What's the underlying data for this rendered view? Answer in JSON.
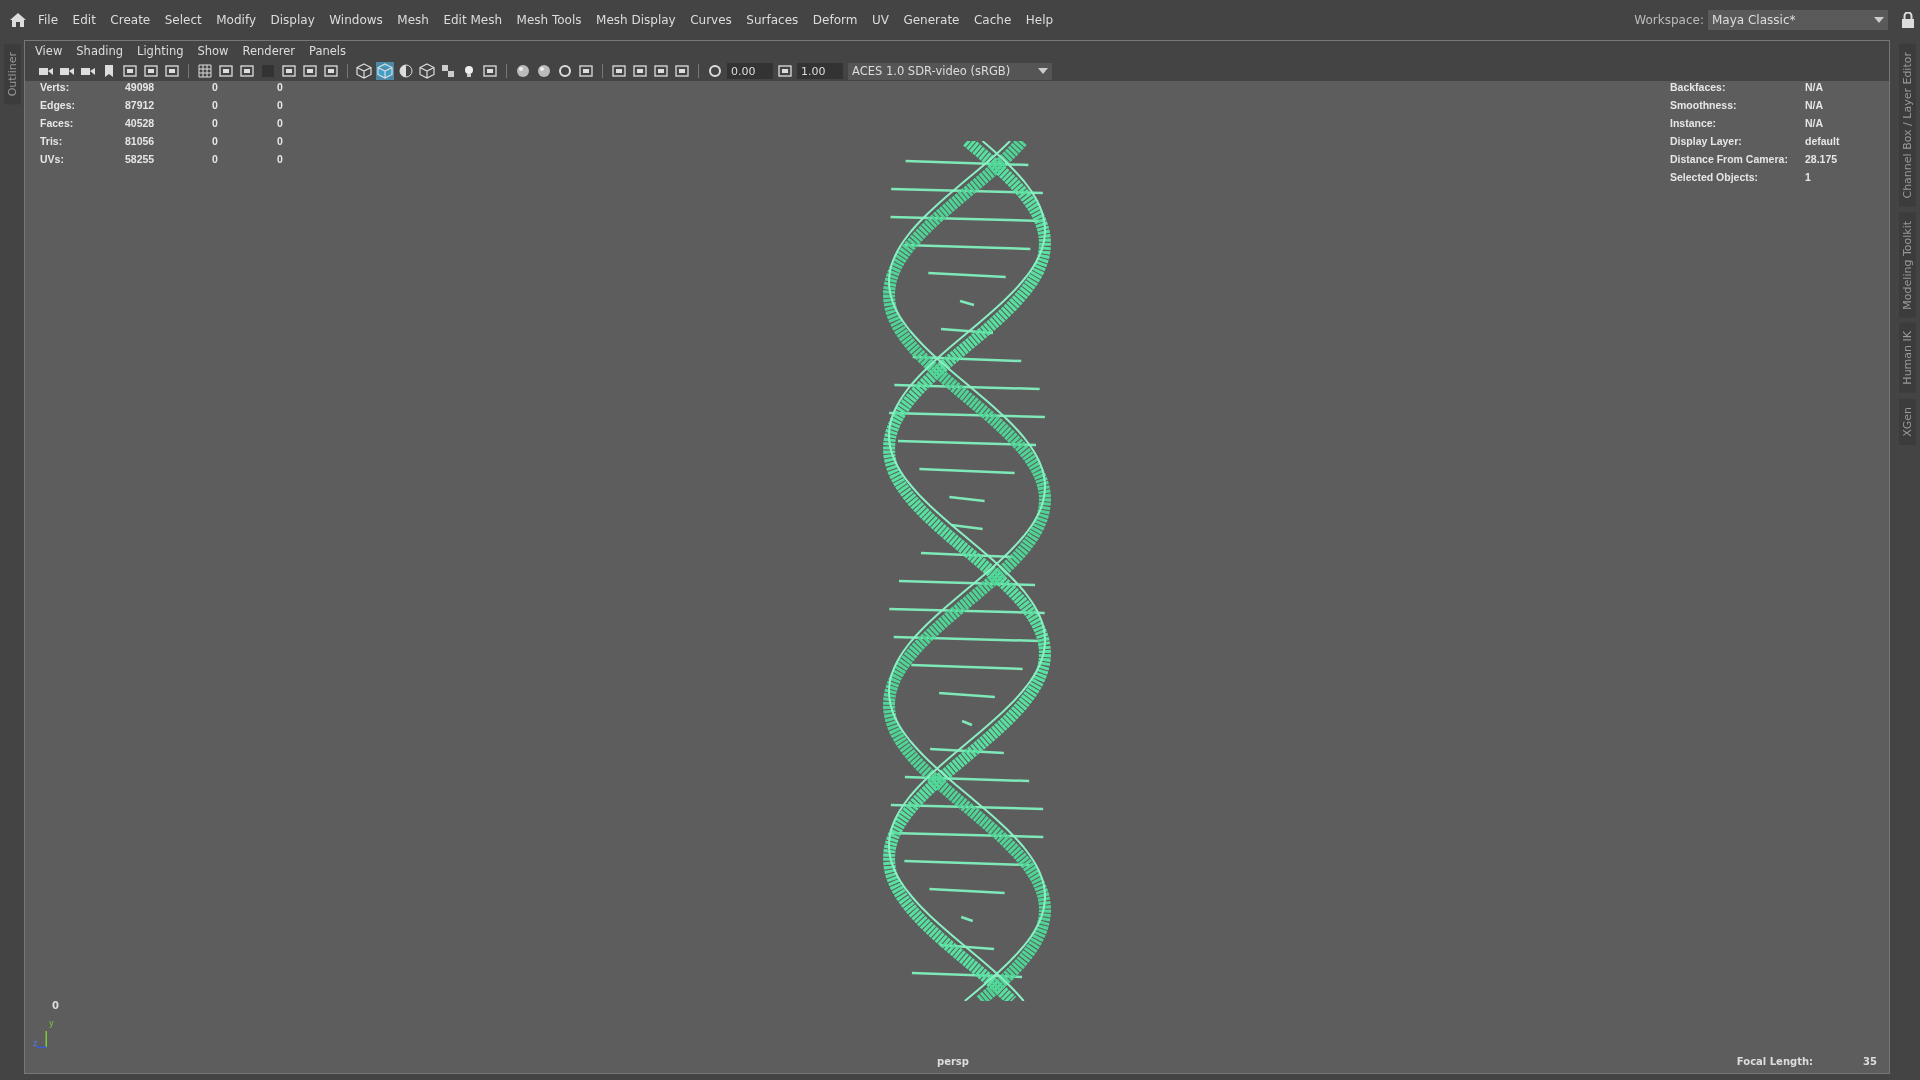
{
  "menu_bar": {
    "items": [
      "File",
      "Edit",
      "Create",
      "Select",
      "Modify",
      "Display",
      "Windows",
      "Mesh",
      "Edit Mesh",
      "Mesh Tools",
      "Mesh Display",
      "Curves",
      "Surfaces",
      "Deform",
      "UV",
      "Generate",
      "Cache",
      "Help"
    ],
    "workspace": {
      "label": "Workspace:",
      "value": "Maya Classic*"
    }
  },
  "left_tabs": [
    "Outliner"
  ],
  "right_tabs": [
    "Channel Box / Layer Editor",
    "Modeling Toolkit",
    "Human IK",
    "XGen"
  ],
  "panel_menu": [
    "View",
    "Shading",
    "Lighting",
    "Show",
    "Renderer",
    "Panels"
  ],
  "toolbar": {
    "buttons": [
      {
        "on": false
      },
      {
        "on": false
      },
      {
        "on": false
      },
      {
        "on": false
      },
      {
        "on": false
      },
      {
        "on": false
      },
      {
        "on": false
      },
      {
        "on": false
      },
      {
        "on": false
      },
      {
        "on": false
      },
      {
        "on": false
      },
      {
        "on": false
      },
      {
        "on": false
      },
      {
        "on": false
      },
      {
        "on": false
      },
      {
        "on": true
      },
      {
        "on": false
      },
      {
        "on": false
      },
      {
        "on": false
      },
      {
        "on": false
      },
      {
        "on": false
      },
      {
        "on": false
      },
      {
        "on": false
      },
      {
        "on": false
      },
      {
        "on": false
      },
      {
        "on": false
      },
      {
        "on": false
      },
      {
        "on": false
      },
      {
        "on": false
      },
      {
        "on": false
      },
      {
        "on": false
      }
    ],
    "exposure": "0.00",
    "gamma": "1.00",
    "color_space": "ACES 1.0 SDR-video (sRGB)"
  },
  "stats_left": [
    {
      "label": "Verts:",
      "value": "49098",
      "column_3": "0",
      "column_4": "0"
    },
    {
      "label": "Edges:",
      "value": "87912",
      "column_3": "0",
      "column_4": "0"
    },
    {
      "label": "Faces:",
      "value": "40528",
      "column_3": "0",
      "column_4": "0"
    },
    {
      "label": "Tris:",
      "value": "81056",
      "column_3": "0",
      "column_4": "0"
    },
    {
      "label": "UVs:",
      "value": "58255",
      "column_3": "0",
      "column_4": "0"
    }
  ],
  "stats_right": [
    {
      "label": "Backfaces:",
      "value": "N/A"
    },
    {
      "label": "Smoothness:",
      "value": "N/A"
    },
    {
      "label": "Instance:",
      "value": "N/A"
    },
    {
      "label": "Display Layer:",
      "value": "default"
    },
    {
      "label": "Distance From Camera:",
      "value": "28.175"
    },
    {
      "label": "Selected Objects:",
      "value": "1"
    }
  ],
  "viewport": {
    "frame": "0",
    "axis_labels": [
      "y",
      "z"
    ],
    "camera": "persp",
    "focal_length": {
      "label": "Focal Length:",
      "value": "35"
    }
  }
}
